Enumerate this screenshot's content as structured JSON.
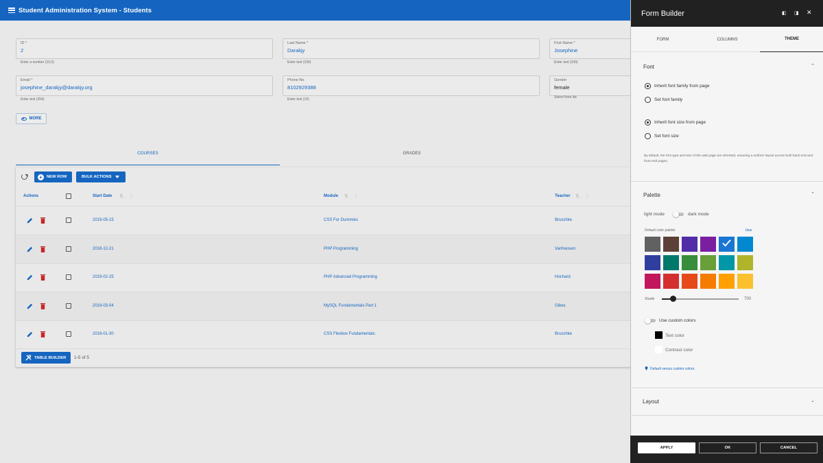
{
  "app": {
    "title": "Student Administration System - Students"
  },
  "form": {
    "id": {
      "label": "ID *",
      "value": "2",
      "hint": "Enter a number (10,0)"
    },
    "last_name": {
      "label": "Last Name *",
      "value": "Darakjy",
      "hint": "Enter text (100)"
    },
    "first_name": {
      "label": "First Name *",
      "value": "Josephine",
      "hint": "Enter text (100)"
    },
    "email": {
      "label": "Email *",
      "value": "josephine_darakjy@darakjy.org",
      "hint": "Enter text (254)"
    },
    "phone": {
      "label": "Phone No",
      "value": "8102929388",
      "hint": "Enter text (10)"
    },
    "gender": {
      "label": "Gender",
      "value": "female",
      "hint": "Select from list"
    },
    "more_label": "MORE"
  },
  "tabs": {
    "courses": "COURSES",
    "grades": "GRADES"
  },
  "table": {
    "new_row_label": "NEW ROW",
    "bulk_actions_label": "BULK ACTIONS",
    "columns": {
      "actions": "Actions",
      "start_date": "Start Date",
      "module": "Module",
      "teacher": "Teacher"
    },
    "rows": [
      {
        "start_date": "2019-05-15",
        "module": "CSS For Dummies",
        "teacher": "Bruschke"
      },
      {
        "start_date": "2018-12-21",
        "module": "PHP Programming",
        "teacher": "Vanheusen"
      },
      {
        "start_date": "2019-02-25",
        "module": "PHP Advanced Programming",
        "teacher": "Hochard"
      },
      {
        "start_date": "2019-03-04",
        "module": "MySQL Fundamentals Part 1",
        "teacher": "Gibes"
      },
      {
        "start_date": "2019-01-30",
        "module": "CSS Flexbox Fundamentals",
        "teacher": "Bruschke"
      }
    ],
    "table_builder_label": "TABLE BUILDER",
    "pager_text": "1-5 of 5"
  },
  "panel": {
    "title": "Form Builder",
    "tabs": {
      "form": "FORM",
      "columns": "COLUMNS",
      "theme": "THEME"
    },
    "font": {
      "title": "Font",
      "inherit_family": "Inherit font family from page",
      "set_family": "Set font family",
      "inherit_size": "Inherit font size from page",
      "set_size": "Set font size",
      "note": "By default, the font type and size of the web page are inherited, ensuring a uniform layout across both back-end and front-end pages."
    },
    "palette": {
      "title": "Palette",
      "light_mode": "light mode",
      "dark_mode": "dark mode",
      "default_palette_label": "Default color palette",
      "selected_name": "blue",
      "shade_label": "Shade",
      "shade_value": "700",
      "use_custom_label": "Use custom colors",
      "text_color_label": "Text color",
      "contrast_color_label": "Contrast color",
      "link_label": "Default versus custom colors."
    },
    "layout": {
      "title": "Layout"
    },
    "footer": {
      "apply": "APPLY",
      "ok": "OK",
      "cancel": "CANCEL"
    }
  },
  "colors": {
    "accent": "#1565c0",
    "swatches": [
      "#616161",
      "#5d4037",
      "#512da8",
      "#7b1fa2",
      "#1976d2",
      "#0288d1",
      "#303f9f",
      "#00796b",
      "#388e3c",
      "#689f38",
      "#0097a7",
      "#afb42b",
      "#c2185b",
      "#d32f2f",
      "#e64a19",
      "#f57c00",
      "#ffa000",
      "#fbc02d"
    ],
    "selected_swatch": 4,
    "text_color": "#000000",
    "contrast_color": "#ffffff"
  }
}
